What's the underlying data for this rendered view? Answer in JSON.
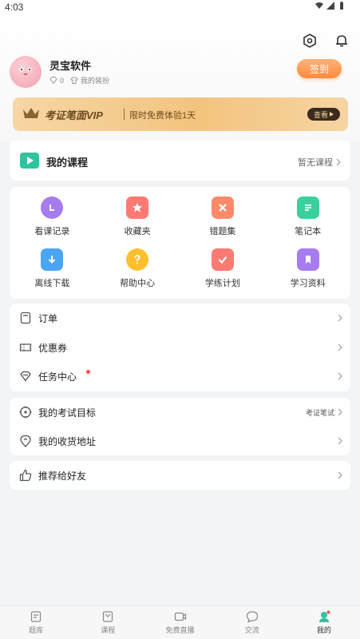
{
  "status": {
    "time": "4:03"
  },
  "icons": [
    "settings-icon",
    "bell-icon",
    "wifi-icon",
    "signal-icon",
    "battery-icon",
    "crown-icon",
    "chevron-right-icon"
  ],
  "profile": {
    "name": "灵宝软件",
    "diamonds": "0",
    "dress_label": "我的装扮",
    "signin_label": "签到"
  },
  "vip": {
    "title": "考证笔面VIP",
    "subtitle": "限时免费体验1天",
    "view_label": "查看"
  },
  "course": {
    "title": "我的课程",
    "right_text": "暂无课程"
  },
  "grid": [
    {
      "label": "看课记录",
      "color": "#a77cf0"
    },
    {
      "label": "收藏夹",
      "color": "#ff7a72"
    },
    {
      "label": "错题集",
      "color": "#ff8a6a"
    },
    {
      "label": "笔记本",
      "color": "#3ccf9e"
    },
    {
      "label": "离线下载",
      "color": "#4aa6f4"
    },
    {
      "label": "帮助中心",
      "color": "#ffbf2e"
    },
    {
      "label": "学练计划",
      "color": "#ff7a72"
    },
    {
      "label": "学习资料",
      "color": "#a77cf0"
    }
  ],
  "menu1": [
    {
      "label": "订单"
    },
    {
      "label": "优惠券"
    },
    {
      "label": "任务中心"
    }
  ],
  "menu2": [
    {
      "label": "我的考试目标",
      "right": "考证笔试"
    },
    {
      "label": "我的收货地址",
      "right": ""
    }
  ],
  "menu3": [
    {
      "label": "推荐给好友"
    }
  ],
  "tabs": [
    {
      "label": "题库"
    },
    {
      "label": "课程"
    },
    {
      "label": "免费直播"
    },
    {
      "label": "交流"
    },
    {
      "label": "我的"
    }
  ],
  "colors": {
    "accent": "#2ec4a0",
    "orange": "#ff8a3d",
    "red_dot": "#ff4d4f"
  }
}
